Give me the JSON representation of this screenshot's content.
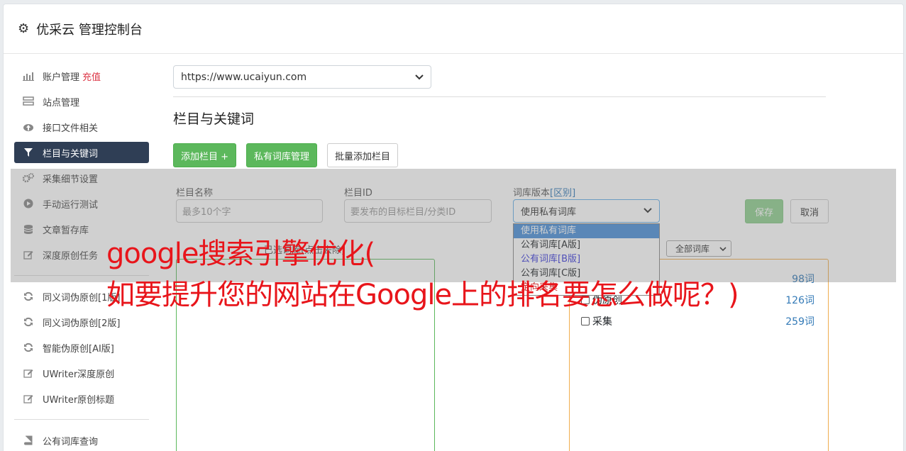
{
  "header": {
    "title": "优采云 管理控制台"
  },
  "sidebar": {
    "items": [
      {
        "label": "账户管理",
        "extra": "充值",
        "icon": "bar-chart-icon"
      },
      {
        "label": "站点管理",
        "icon": "server-icon"
      },
      {
        "label": "接口文件相关",
        "icon": "cloud-upload-icon"
      },
      {
        "label": "栏目与关键词",
        "icon": "filter-icon",
        "active": true
      },
      {
        "label": "采集细节设置",
        "icon": "gears-icon"
      },
      {
        "label": "手动运行测试",
        "icon": "play-circle-icon"
      },
      {
        "label": "文章暂存库",
        "icon": "database-icon"
      },
      {
        "label": "深度原创任务",
        "icon": "edit-icon"
      },
      {
        "label": "同义词伪原创[1版]",
        "icon": "refresh-icon"
      },
      {
        "label": "同义词伪原创[2版]",
        "icon": "refresh-icon"
      },
      {
        "label": "智能伪原创[AI版]",
        "icon": "refresh-icon"
      },
      {
        "label": "UWriter深度原创",
        "icon": "edit-icon"
      },
      {
        "label": "UWriter原创标题",
        "icon": "edit-icon"
      },
      {
        "label": "公有词库查询",
        "icon": "book-icon"
      }
    ]
  },
  "main": {
    "site_select": "https://www.ucaiyun.com",
    "section_title": "栏目与关键词",
    "buttons": {
      "add_column": "添加栏目 +",
      "private_lib": "私有词库管理",
      "batch_add": "批量添加栏目"
    },
    "form": {
      "name_label": "栏目名称",
      "name_placeholder": "最多10个字",
      "id_label": "栏目ID",
      "id_placeholder": "要发布的目标栏目/分类ID",
      "version_label": "词库版本",
      "version_link": "[区别]",
      "version_value": "使用私有词库",
      "version_options": [
        "使用私有词库",
        "公有词库[A版]",
        "公有词库[B版]",
        "公有词库[C版]",
        "定向采集"
      ],
      "save": "保存",
      "cancel": "取消",
      "chosen_hint": "已选词库(点击去除)",
      "all_libs": "全部词库"
    },
    "libraries": [
      {
        "name": "",
        "count": "98词"
      },
      {
        "name": "伪原创",
        "count": "126词"
      },
      {
        "name": "采集",
        "count": "259词"
      }
    ]
  },
  "banner": {
    "line1": "google搜索引擎优化(",
    "line2": "如要提升您的网站在Google上的排名要怎么做呢？)"
  }
}
